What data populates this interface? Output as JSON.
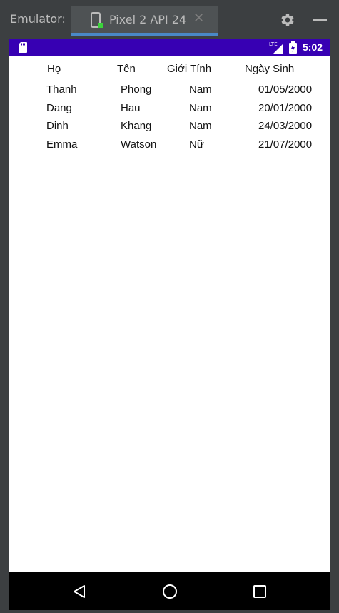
{
  "emulator": {
    "label": "Emulator:",
    "tab_title": "Pixel 2 API 24",
    "close_glyph": "✕"
  },
  "status_bar": {
    "network": "LTE",
    "time": "5:02",
    "color": "#3700b3"
  },
  "table": {
    "headers": [
      "Họ",
      "Tên",
      "Giới Tính",
      "Ngày Sinh"
    ],
    "rows": [
      [
        "Thanh",
        "Phong",
        "Nam",
        "01/05/2000"
      ],
      [
        "Dang",
        "Hau",
        "Nam",
        "20/01/2000"
      ],
      [
        "Dinh",
        "Khang",
        "Nam",
        "24/03/2000"
      ],
      [
        "Emma",
        "Watson",
        "Nữ",
        "21/07/2000"
      ]
    ]
  },
  "nav": {
    "icons": [
      "back-icon",
      "home-icon",
      "recents-icon"
    ]
  }
}
